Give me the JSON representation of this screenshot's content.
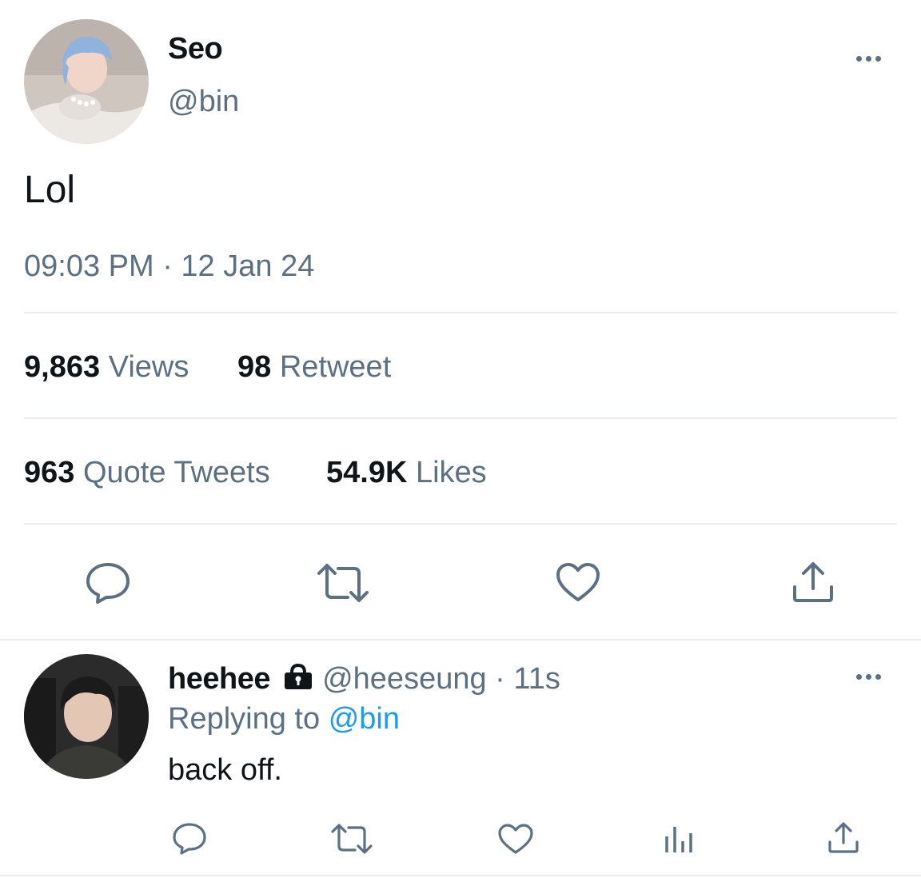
{
  "main_tweet": {
    "author_name": "Seo",
    "author_handle": "@bin",
    "text": "Lol",
    "timestamp": "09:03 PM · 12 Jan 24",
    "stats": {
      "views_count": "9,863",
      "views_label": "Views",
      "retweets_count": "98",
      "retweets_label": "Retweet",
      "quotes_count": "963",
      "quotes_label": "Quote Tweets",
      "likes_count": "54.9K",
      "likes_label": "Likes"
    },
    "icons": [
      "reply-icon",
      "retweet-icon",
      "like-icon",
      "share-icon"
    ]
  },
  "reply_tweet": {
    "author_name": "heehee",
    "author_handle": "@heeseung",
    "time_ago": "· 11s",
    "replying_prefix": "Replying to",
    "replying_to": "@bin",
    "text": "back off.",
    "icons": [
      "reply-icon",
      "retweet-icon",
      "like-icon",
      "analytics-icon",
      "share-icon"
    ]
  },
  "colors": {
    "text": "#0f1419",
    "muted": "#5b7083",
    "link": "#1d9bf0",
    "divider": "#e8ecef"
  }
}
